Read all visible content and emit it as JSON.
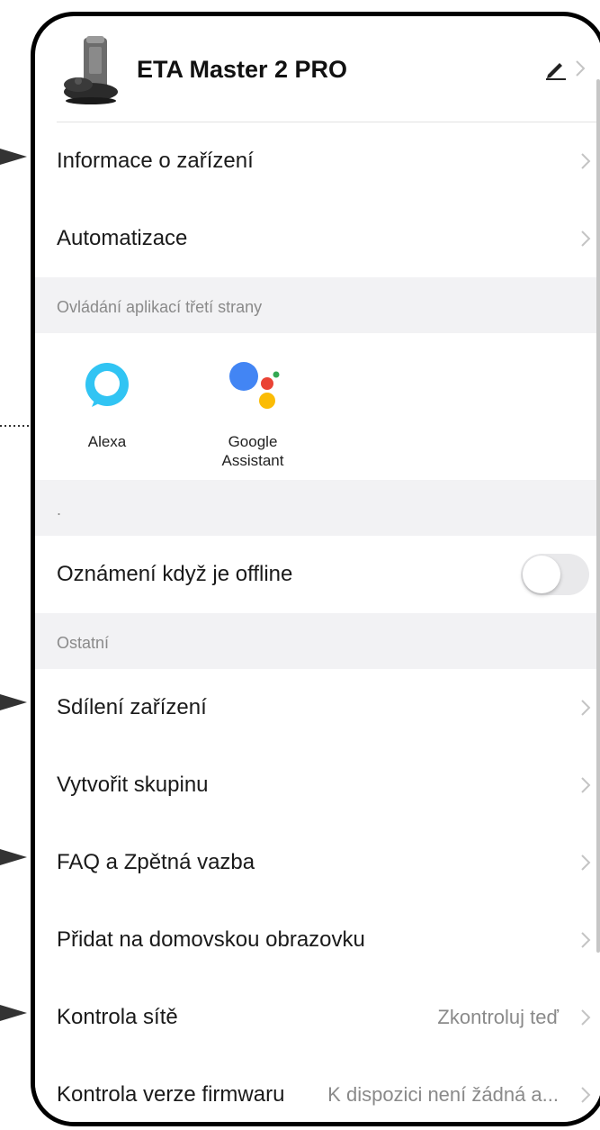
{
  "device": {
    "title": "ETA Master 2 PRO",
    "edit_icon": "pencil-icon",
    "chevron_icon": "chevron-right-icon"
  },
  "menu_top": [
    {
      "label": "Informace o zařízení"
    },
    {
      "label": "Automatizace"
    }
  ],
  "third_party": {
    "section_title": "Ovládání aplikací třetí strany",
    "apps": [
      {
        "name": "Alexa",
        "icon": "alexa-icon"
      },
      {
        "name": "Google Assistant",
        "icon": "google-assistant-icon"
      }
    ]
  },
  "dot_section": {
    "title": "."
  },
  "offline_notify": {
    "label": "Oznámení když je offline",
    "enabled": false
  },
  "others": {
    "section_title": "Ostatní",
    "items": [
      {
        "label": "Sdílení zařízení"
      },
      {
        "label": "Vytvořit skupinu"
      },
      {
        "label": "FAQ a Zpětná vazba"
      },
      {
        "label": "Přidat na domovskou obrazovku"
      },
      {
        "label": "Kontrola sítě",
        "value": "Zkontroluj teď"
      },
      {
        "label": "Kontrola verze firmwaru",
        "value": "K dispozici není žádná a..."
      }
    ]
  },
  "colors": {
    "section_bg": "#f2f2f4",
    "alexa": "#31c4f3",
    "google_blue": "#4285F4",
    "google_red": "#EA4335",
    "google_yellow": "#FBBC05",
    "google_green": "#34A853"
  }
}
